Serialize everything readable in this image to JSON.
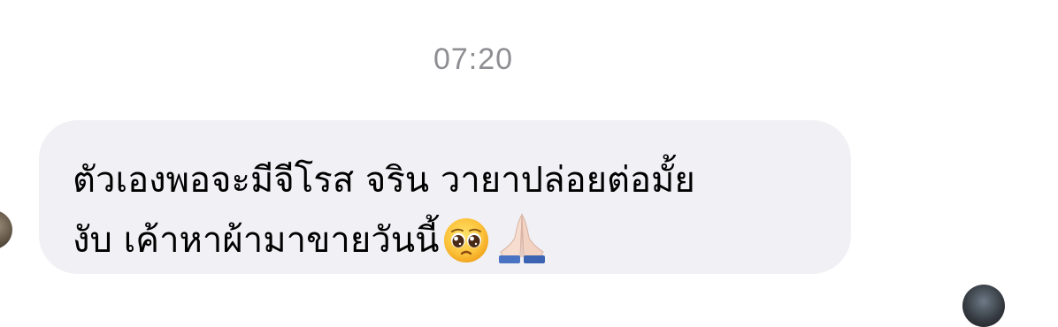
{
  "conversation": {
    "timestamp": "07:20",
    "message": {
      "line1": "ตัวเองพอจะมีจีโรส จริน วายาปล่อยต่อมั้ย",
      "line2": "งับ เค้าหาผ้ามาขายวันนี้",
      "emojis": [
        "pleading-face",
        "folded-hands"
      ]
    },
    "avatars": {
      "left": "contact-avatar",
      "right": "own-avatar"
    },
    "colors": {
      "bubble": "#f0f0f5",
      "timestamp": "#8e8e93",
      "text": "#000000",
      "background": "#ffffff"
    }
  }
}
